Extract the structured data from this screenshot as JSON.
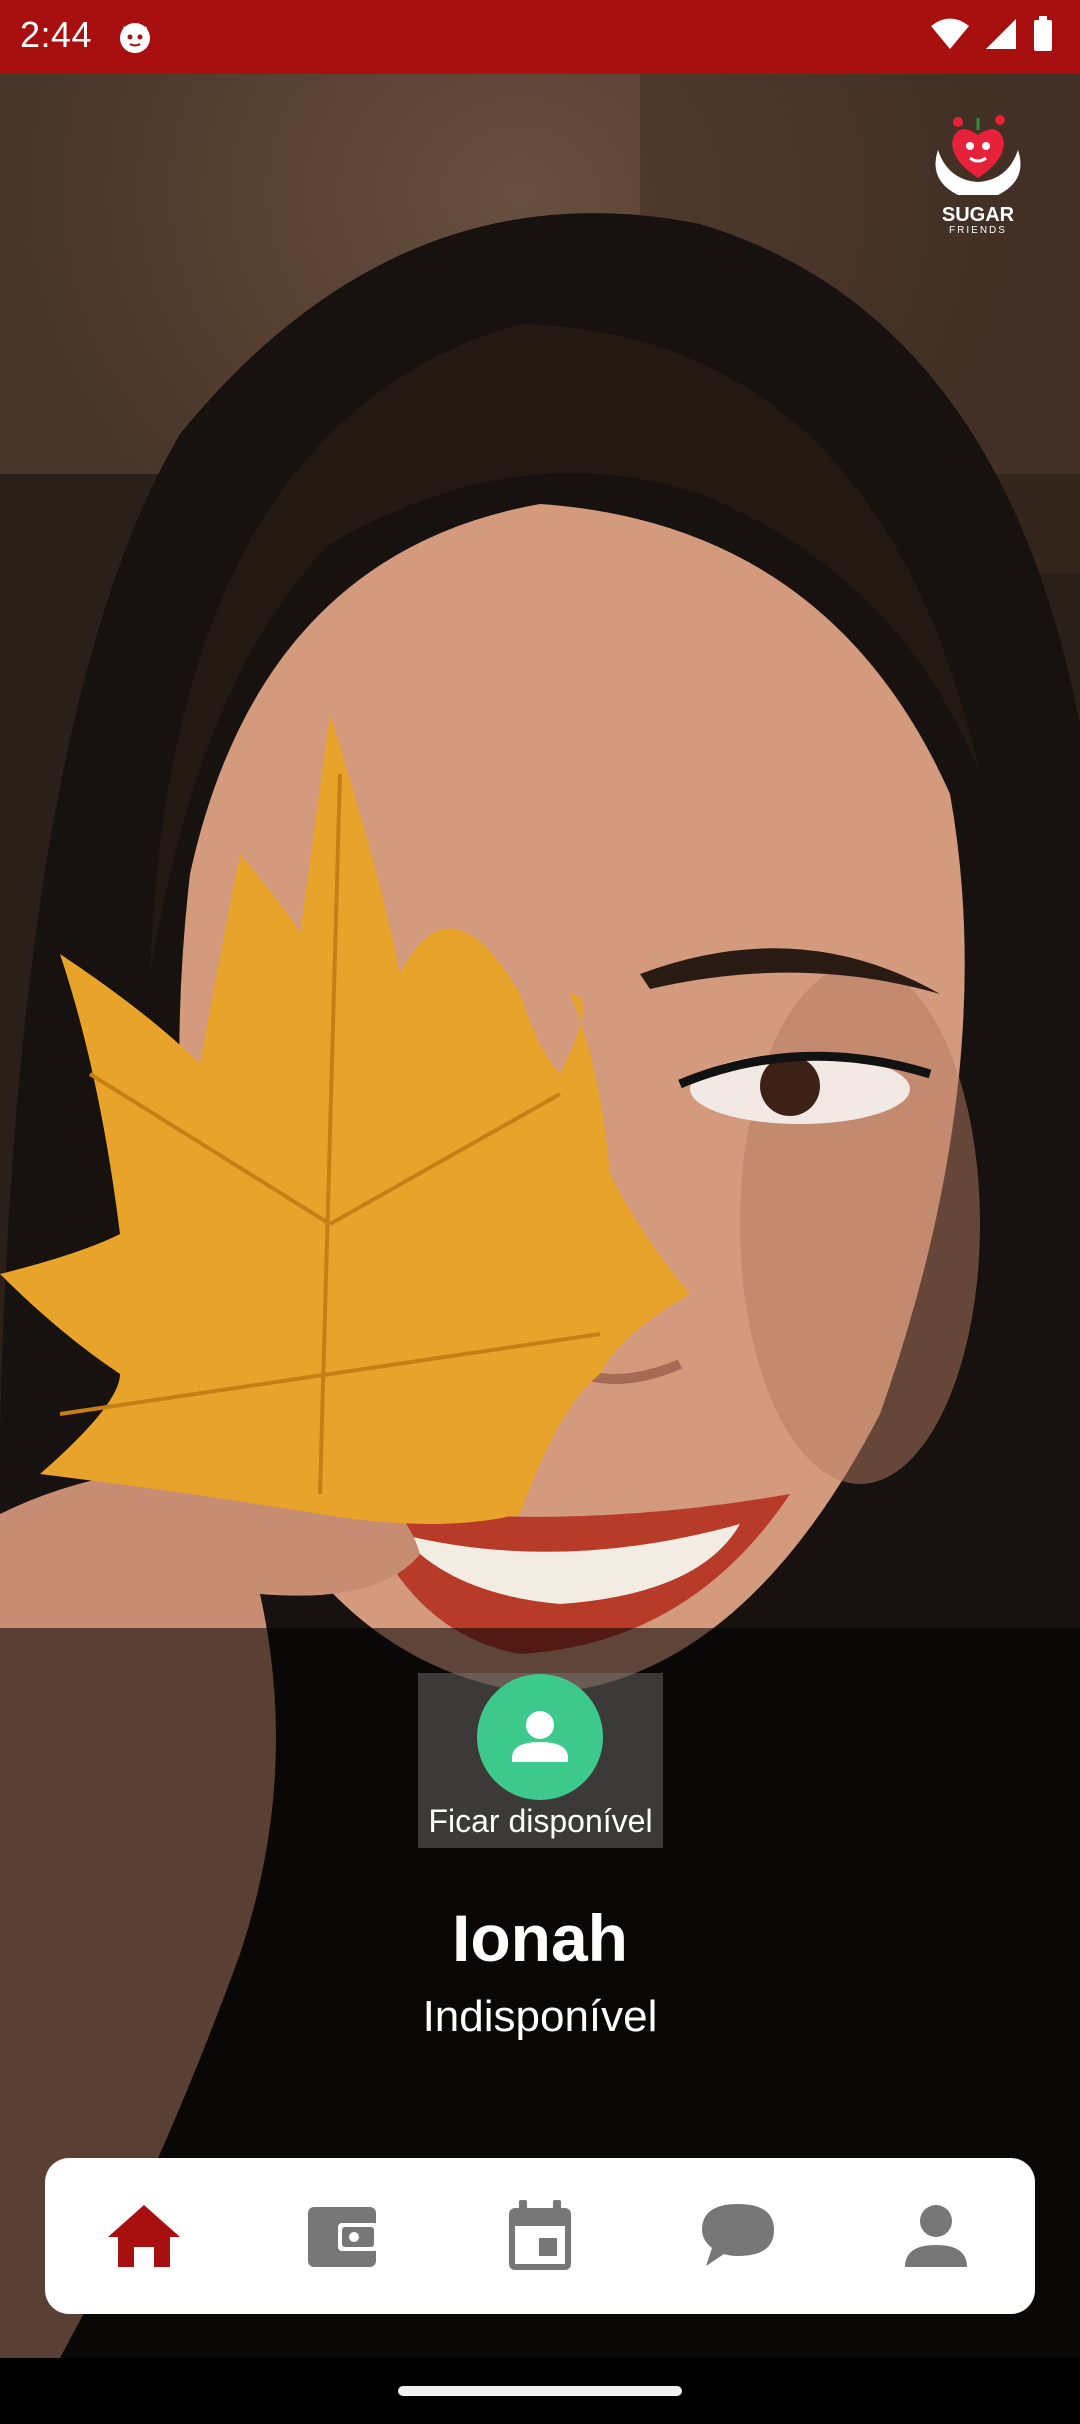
{
  "status_bar": {
    "time": "2:44",
    "app_icon": "cat-face-icon",
    "icons": [
      "wifi-icon",
      "signal-icon",
      "battery-icon"
    ],
    "background": "#a8100f"
  },
  "logo": {
    "title": "SUGAR",
    "subtitle": "FRIENDS",
    "icon": "heart-hands-logo"
  },
  "availability_button": {
    "label": "Ficar disponível",
    "icon": "person-icon",
    "color": "#3ec98c"
  },
  "profile": {
    "name": "Ionah",
    "status": "Indisponível"
  },
  "bottom_nav": {
    "items": [
      {
        "icon": "home-icon",
        "active": true
      },
      {
        "icon": "wallet-icon",
        "active": false
      },
      {
        "icon": "calendar-icon",
        "active": false
      },
      {
        "icon": "chat-icon",
        "active": false
      },
      {
        "icon": "profile-icon",
        "active": false
      }
    ],
    "active_color": "#a8100f",
    "inactive_color": "#777777"
  }
}
